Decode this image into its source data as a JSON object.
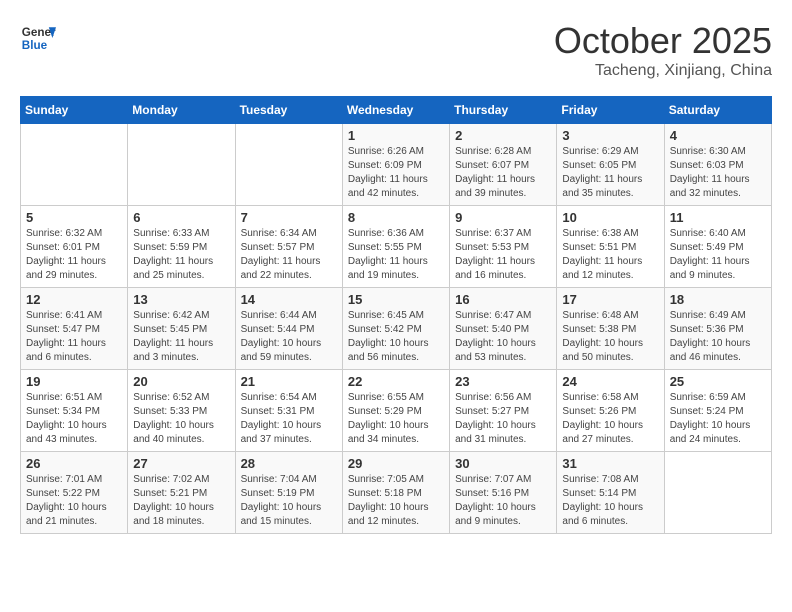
{
  "header": {
    "logo_line1": "General",
    "logo_line2": "Blue",
    "month": "October 2025",
    "location": "Tacheng, Xinjiang, China"
  },
  "weekdays": [
    "Sunday",
    "Monday",
    "Tuesday",
    "Wednesday",
    "Thursday",
    "Friday",
    "Saturday"
  ],
  "weeks": [
    [
      {
        "day": "",
        "info": ""
      },
      {
        "day": "",
        "info": ""
      },
      {
        "day": "",
        "info": ""
      },
      {
        "day": "1",
        "info": "Sunrise: 6:26 AM\nSunset: 6:09 PM\nDaylight: 11 hours\nand 42 minutes."
      },
      {
        "day": "2",
        "info": "Sunrise: 6:28 AM\nSunset: 6:07 PM\nDaylight: 11 hours\nand 39 minutes."
      },
      {
        "day": "3",
        "info": "Sunrise: 6:29 AM\nSunset: 6:05 PM\nDaylight: 11 hours\nand 35 minutes."
      },
      {
        "day": "4",
        "info": "Sunrise: 6:30 AM\nSunset: 6:03 PM\nDaylight: 11 hours\nand 32 minutes."
      }
    ],
    [
      {
        "day": "5",
        "info": "Sunrise: 6:32 AM\nSunset: 6:01 PM\nDaylight: 11 hours\nand 29 minutes."
      },
      {
        "day": "6",
        "info": "Sunrise: 6:33 AM\nSunset: 5:59 PM\nDaylight: 11 hours\nand 25 minutes."
      },
      {
        "day": "7",
        "info": "Sunrise: 6:34 AM\nSunset: 5:57 PM\nDaylight: 11 hours\nand 22 minutes."
      },
      {
        "day": "8",
        "info": "Sunrise: 6:36 AM\nSunset: 5:55 PM\nDaylight: 11 hours\nand 19 minutes."
      },
      {
        "day": "9",
        "info": "Sunrise: 6:37 AM\nSunset: 5:53 PM\nDaylight: 11 hours\nand 16 minutes."
      },
      {
        "day": "10",
        "info": "Sunrise: 6:38 AM\nSunset: 5:51 PM\nDaylight: 11 hours\nand 12 minutes."
      },
      {
        "day": "11",
        "info": "Sunrise: 6:40 AM\nSunset: 5:49 PM\nDaylight: 11 hours\nand 9 minutes."
      }
    ],
    [
      {
        "day": "12",
        "info": "Sunrise: 6:41 AM\nSunset: 5:47 PM\nDaylight: 11 hours\nand 6 minutes."
      },
      {
        "day": "13",
        "info": "Sunrise: 6:42 AM\nSunset: 5:45 PM\nDaylight: 11 hours\nand 3 minutes."
      },
      {
        "day": "14",
        "info": "Sunrise: 6:44 AM\nSunset: 5:44 PM\nDaylight: 10 hours\nand 59 minutes."
      },
      {
        "day": "15",
        "info": "Sunrise: 6:45 AM\nSunset: 5:42 PM\nDaylight: 10 hours\nand 56 minutes."
      },
      {
        "day": "16",
        "info": "Sunrise: 6:47 AM\nSunset: 5:40 PM\nDaylight: 10 hours\nand 53 minutes."
      },
      {
        "day": "17",
        "info": "Sunrise: 6:48 AM\nSunset: 5:38 PM\nDaylight: 10 hours\nand 50 minutes."
      },
      {
        "day": "18",
        "info": "Sunrise: 6:49 AM\nSunset: 5:36 PM\nDaylight: 10 hours\nand 46 minutes."
      }
    ],
    [
      {
        "day": "19",
        "info": "Sunrise: 6:51 AM\nSunset: 5:34 PM\nDaylight: 10 hours\nand 43 minutes."
      },
      {
        "day": "20",
        "info": "Sunrise: 6:52 AM\nSunset: 5:33 PM\nDaylight: 10 hours\nand 40 minutes."
      },
      {
        "day": "21",
        "info": "Sunrise: 6:54 AM\nSunset: 5:31 PM\nDaylight: 10 hours\nand 37 minutes."
      },
      {
        "day": "22",
        "info": "Sunrise: 6:55 AM\nSunset: 5:29 PM\nDaylight: 10 hours\nand 34 minutes."
      },
      {
        "day": "23",
        "info": "Sunrise: 6:56 AM\nSunset: 5:27 PM\nDaylight: 10 hours\nand 31 minutes."
      },
      {
        "day": "24",
        "info": "Sunrise: 6:58 AM\nSunset: 5:26 PM\nDaylight: 10 hours\nand 27 minutes."
      },
      {
        "day": "25",
        "info": "Sunrise: 6:59 AM\nSunset: 5:24 PM\nDaylight: 10 hours\nand 24 minutes."
      }
    ],
    [
      {
        "day": "26",
        "info": "Sunrise: 7:01 AM\nSunset: 5:22 PM\nDaylight: 10 hours\nand 21 minutes."
      },
      {
        "day": "27",
        "info": "Sunrise: 7:02 AM\nSunset: 5:21 PM\nDaylight: 10 hours\nand 18 minutes."
      },
      {
        "day": "28",
        "info": "Sunrise: 7:04 AM\nSunset: 5:19 PM\nDaylight: 10 hours\nand 15 minutes."
      },
      {
        "day": "29",
        "info": "Sunrise: 7:05 AM\nSunset: 5:18 PM\nDaylight: 10 hours\nand 12 minutes."
      },
      {
        "day": "30",
        "info": "Sunrise: 7:07 AM\nSunset: 5:16 PM\nDaylight: 10 hours\nand 9 minutes."
      },
      {
        "day": "31",
        "info": "Sunrise: 7:08 AM\nSunset: 5:14 PM\nDaylight: 10 hours\nand 6 minutes."
      },
      {
        "day": "",
        "info": ""
      }
    ]
  ]
}
